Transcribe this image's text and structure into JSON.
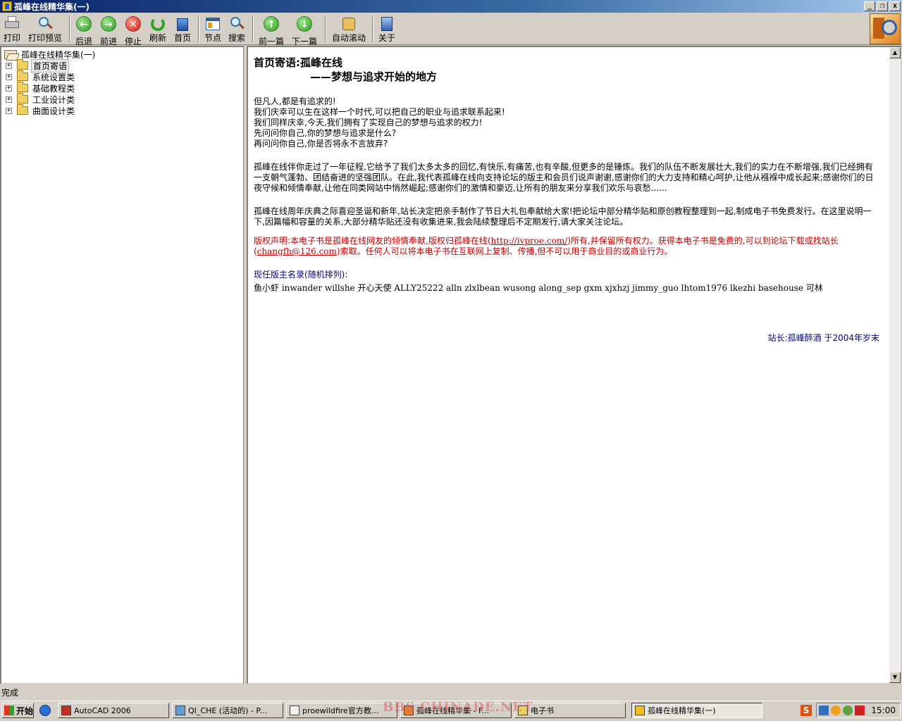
{
  "window": {
    "title": "孤峰在线精华集(一)",
    "buttons": {
      "minimize": "_",
      "restore": "❐",
      "close": "x"
    }
  },
  "toolbar": {
    "print": "打印",
    "print_preview": "打印预览",
    "back": "后退",
    "forward": "前进",
    "stop": "停止",
    "refresh": "刷新",
    "home": "首页",
    "nodes": "节点",
    "search": "搜索",
    "prev_article": "前一篇",
    "next_article": "下一篇",
    "auto_scroll": "自动滚动",
    "about": "关于"
  },
  "tree": {
    "root": "孤峰在线精华集(一)",
    "items": [
      {
        "label": "首页寄语",
        "selected": true
      },
      {
        "label": "系统设置类",
        "selected": false
      },
      {
        "label": "基础教程类",
        "selected": false
      },
      {
        "label": "工业设计类",
        "selected": false
      },
      {
        "label": "曲面设计类",
        "selected": false
      }
    ],
    "expander": "+"
  },
  "content": {
    "title": "首页寄语:孤峰在线",
    "subtitle": "——梦想与追求开始的地方",
    "intro_lines": [
      "但凡人,都是有追求的!",
      "我们庆幸可以生在这样一个时代,可以把自己的职业与追求联系起来!",
      "我们同样庆幸,今天,我们拥有了实现自己的梦想与追求的权力!",
      "先问问你自己,你的梦想与追求是什么?",
      "再问问你自己,你是否将永不言放弃?"
    ],
    "paragraph1": "孤峰在线伴你走过了一年征程,它给予了我们太多太多的回忆,有快乐,有痛苦,也有辛酸,但更多的是锤炼。我们的队伍不断发展壮大,我们的实力在不断增强,我们已经拥有一支朝气蓬勃、团结奋进的坚强团队。在此,我代表孤峰在线向支持论坛的版主和会员们说声谢谢,感谢你们的大力支持和精心呵护,让他从襁褓中成长起来;感谢你们的日夜守候和倾情奉献,让他在同类网站中悄然崛起;感谢你们的激情和豪迈,让所有的朋友来分享我们欢乐与哀愁......",
    "paragraph2": "孤峰在线周年庆典之际喜迎圣诞和新年,站长决定把亲手制作了节日大礼包奉献给大家!把论坛中部分精华贴和原创教程整理到一起,制成电子书免费发行。在这里说明一下,因篇幅和容量的关系,大部分精华贴还没有收集进来,我会陆续整理后不定期发行,请大家关注论坛。",
    "copyright_part1": "版权声明:本电子书是孤峰在线网友的倾情奉献,版权归孤峰在线(",
    "copyright_link1": "http://ivproe.com/",
    "copyright_part2": ")所有,并保留所有权力。获得本电子书是免费的,可以到论坛下载或找站长(",
    "copyright_link2": "changfh@126.com",
    "copyright_part3": ")索取。任何人可以将本电子书在互联网上复制、传播,但不可以用于商业目的或商业行为。",
    "moderators_heading": "现任版主名录(随机排列):",
    "moderators": "鱼小虾 inwander  willshe 开心天使 ALLY25222 alln zlxlbean wusong along_sep gxm xjxhzj jimmy_guo lhtom1976 lkezhi basehouse 可林",
    "signature": "站长:孤峰醉酒 于2004年岁末"
  },
  "status": {
    "text": "完成"
  },
  "taskbar": {
    "start": "开始",
    "tasks": [
      {
        "label": "AutoCAD 2006",
        "active": false
      },
      {
        "label": "QI_CHE (活动的) - P...",
        "active": false
      },
      {
        "label": "proewildfire官方教...",
        "active": false
      },
      {
        "label": "孤峰在线精华集 - F...",
        "active": false
      },
      {
        "label": "电子书",
        "active": false
      },
      {
        "label": "孤峰在线精华集(一)",
        "active": true
      }
    ],
    "watermark": "BBS.CHINADE.NET",
    "ime": "S",
    "clock": "15:00"
  },
  "colors": {
    "accent_red": "#c00000",
    "accent_blue": "#000080",
    "titlebar": "#0a246a"
  }
}
